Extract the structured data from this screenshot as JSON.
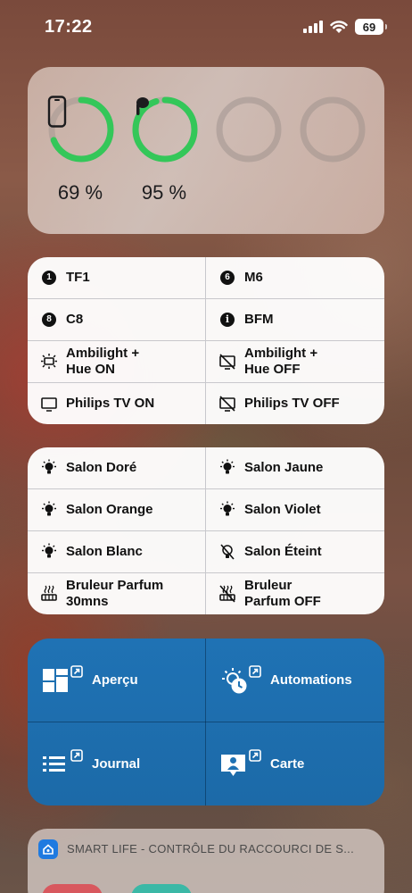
{
  "status_bar": {
    "time": "17:22",
    "battery_level": "69",
    "icons": [
      "cellular-signal-icon",
      "wifi-icon",
      "battery-icon"
    ]
  },
  "battery_widget": {
    "devices": [
      {
        "icon": "iphone-icon",
        "percent_label": "69 %",
        "level": 0.69,
        "color": "#34c759"
      },
      {
        "icon": "airpods-icon",
        "percent_label": "95 %",
        "level": 0.95,
        "color": "#34c759"
      },
      {
        "icon": "",
        "percent_label": "",
        "level": 0,
        "color": "#b8b2ae"
      },
      {
        "icon": "",
        "percent_label": "",
        "level": 0,
        "color": "#b8b2ae"
      }
    ]
  },
  "tv_widget": {
    "buttons": [
      {
        "label": "TF1",
        "icon": "number-1-icon",
        "badge": "1"
      },
      {
        "label": "M6",
        "icon": "number-6-icon",
        "badge": "6"
      },
      {
        "label": "C8",
        "icon": "number-8-icon",
        "badge": "8"
      },
      {
        "label": "BFM",
        "icon": "info-icon",
        "badge": "i"
      },
      {
        "label": "Ambilight + Hue ON",
        "line1": "Ambilight +",
        "line2": "Hue ON",
        "icon": "ambilight-on-icon"
      },
      {
        "label": "Ambilight + Hue OFF",
        "line1": "Ambilight +",
        "line2": "Hue OFF",
        "icon": "tv-off-icon"
      },
      {
        "label": "Philips TV ON",
        "icon": "tv-icon"
      },
      {
        "label": "Philips TV OFF",
        "icon": "tv-off-icon"
      }
    ]
  },
  "lights_widget": {
    "buttons": [
      {
        "label": "Salon Doré",
        "icon": "lightbulb-icon"
      },
      {
        "label": "Salon Jaune",
        "icon": "lightbulb-icon"
      },
      {
        "label": "Salon Orange",
        "icon": "lightbulb-icon"
      },
      {
        "label": "Salon Violet",
        "icon": "lightbulb-icon"
      },
      {
        "label": "Salon Blanc",
        "icon": "lightbulb-icon"
      },
      {
        "label": "Salon Éteint",
        "icon": "lightbulb-off-icon"
      },
      {
        "label": "Bruleur Parfum 30mns",
        "line1": "Bruleur Parfum",
        "line2": "30mns",
        "icon": "heater-icon"
      },
      {
        "label": "Bruleur Parfum OFF",
        "line1": "Bruleur",
        "line2": "Parfum OFF",
        "icon": "heater-off-icon"
      }
    ]
  },
  "home_widget": {
    "color": "#1f72b4",
    "buttons": [
      {
        "label": "Aperçu",
        "icon": "overview-grid-icon"
      },
      {
        "label": "Automations",
        "icon": "automation-clock-icon"
      },
      {
        "label": "Journal",
        "icon": "journal-list-icon"
      },
      {
        "label": "Carte",
        "icon": "map-person-icon"
      }
    ]
  },
  "smart_life_widget": {
    "title": "SMART LIFE - CONTRÔLE DU RACCOURCI DE S..."
  }
}
